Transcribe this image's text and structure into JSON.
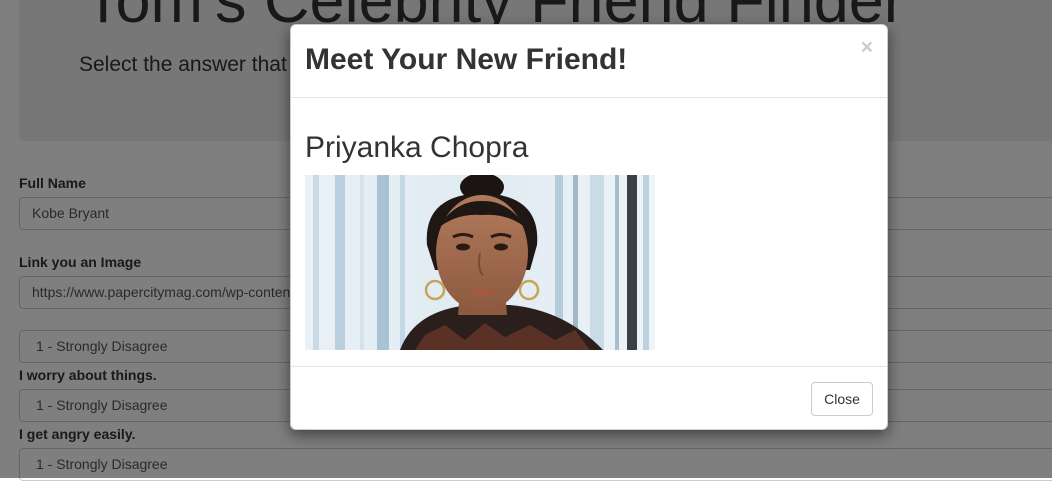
{
  "page": {
    "title": "Tom's Celebrity Friend Finder",
    "subtitle": "Select the answer that"
  },
  "form": {
    "name_label": "Full Name",
    "name_value": "Kobe Bryant",
    "image_label": "Link you an Image",
    "image_value": "https://www.papercitymag.com/wp-content",
    "questions": [
      {
        "label": "",
        "answer": "1 - Strongly Disagree"
      },
      {
        "label": "I worry about things.",
        "answer": "1 - Strongly Disagree"
      },
      {
        "label": "I get angry easily.",
        "answer": "1 - Strongly Disagree"
      }
    ]
  },
  "modal": {
    "title": "Meet Your New Friend!",
    "close_symbol": "×",
    "friend_name": "Priyanka Chopra",
    "close_button": "Close"
  },
  "colors": {
    "backdrop": "#000000",
    "jumbotron": "#eeeeee",
    "text": "#333333"
  }
}
